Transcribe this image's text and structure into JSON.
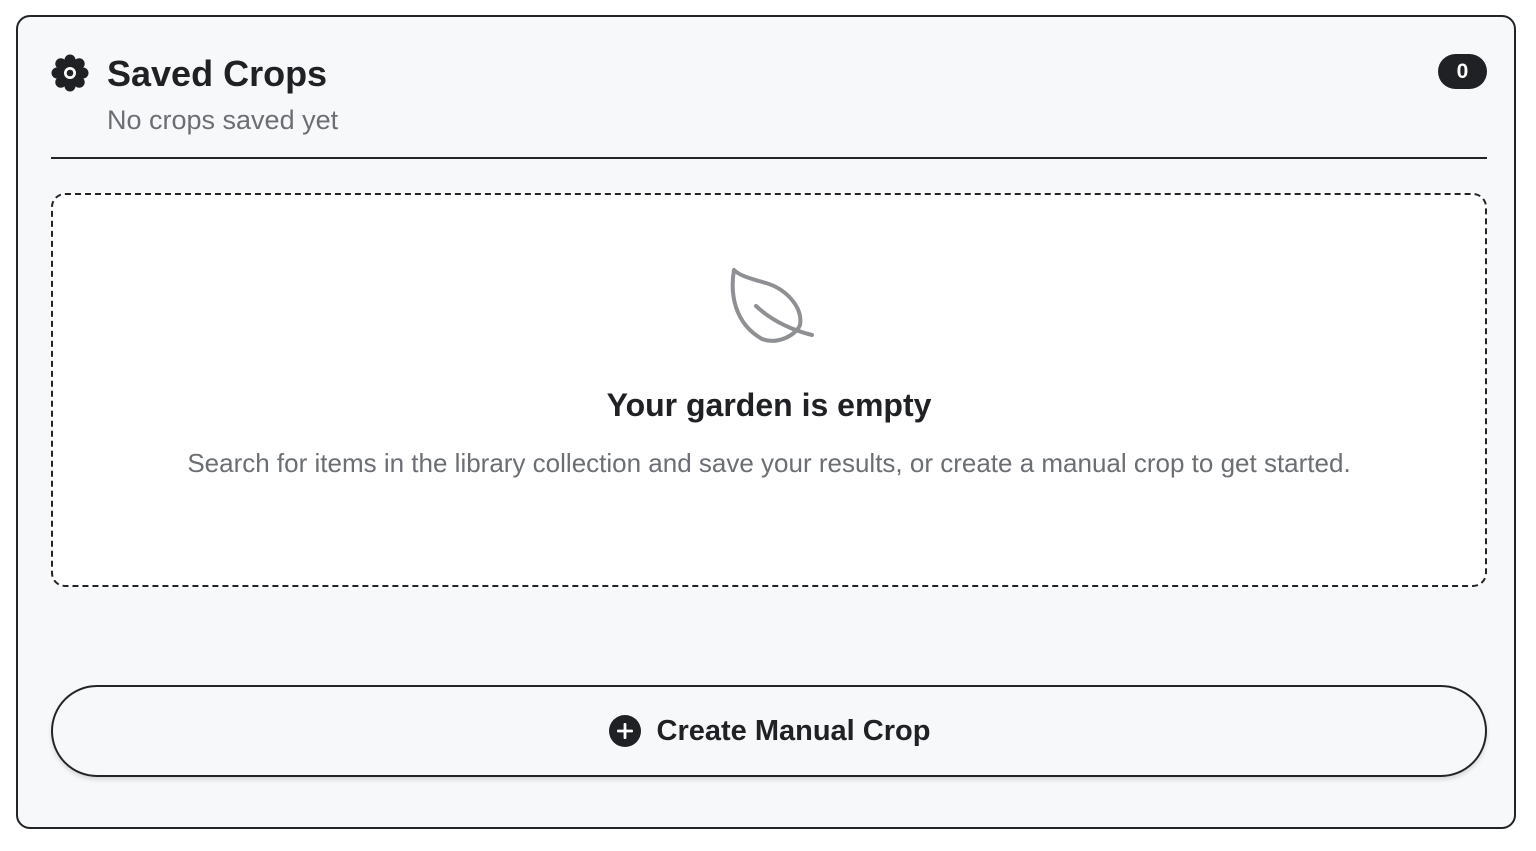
{
  "panel": {
    "icon": "gear-icon",
    "title": "Saved Crops",
    "subtitle": "No crops saved yet",
    "count": "0"
  },
  "empty_state": {
    "icon": "leaf-icon",
    "title": "Your garden is empty",
    "description": "Search for items in the library collection and save your results, or create a manual crop to get started."
  },
  "actions": {
    "create_icon": "plus-circle-icon",
    "create_label": "Create Manual Crop"
  },
  "colors": {
    "text_primary": "#202124",
    "text_secondary": "#6b6e73",
    "border": "#222427",
    "panel_bg": "#f7f8fa",
    "badge_bg": "#1f2125",
    "icon_muted": "#8f9093"
  }
}
